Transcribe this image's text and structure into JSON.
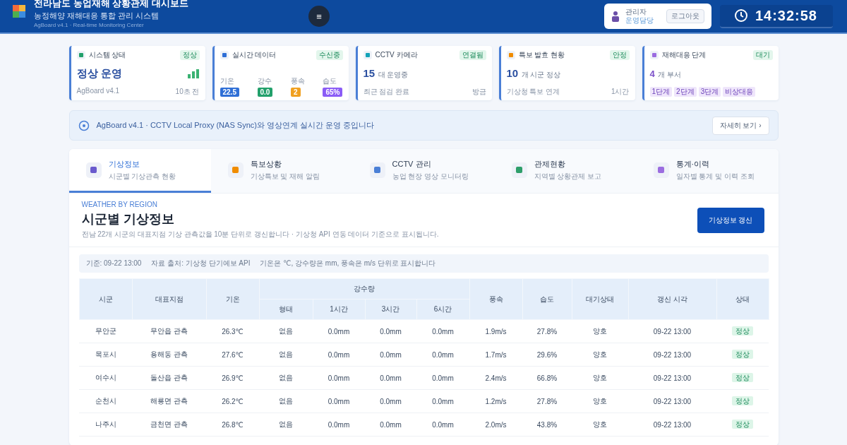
{
  "header": {
    "title": "전라남도 농업재해 상황관제 대시보드",
    "subtitle": "농정해양 재해대응 통합 관리 시스템",
    "caption": "AgBoard v4.1 · Real-time Monitoring Center",
    "menu_button": "≡",
    "user": {
      "name": "관리자",
      "role": "운영담당",
      "logout": "로그아웃"
    },
    "clock": "14:32:58"
  },
  "stat_cards": [
    {
      "kind": "value",
      "title": "시스템 상태",
      "badge": "정상",
      "color": "#22a06b",
      "value": "정상 운영",
      "footer_left": "AgBoard v4.1",
      "footer_right": "10초 전"
    },
    {
      "kind": "metrics",
      "title": "실시간 데이터",
      "badge": "수신중",
      "color": "#2f6fd6",
      "metrics": [
        {
          "label": "기온",
          "value": "22.5",
          "color": "#2f6fd6"
        },
        {
          "label": "강수",
          "value": "0.0",
          "color": "#22a06b"
        },
        {
          "label": "풍속",
          "value": "2",
          "color": "#f0a020"
        },
        {
          "label": "습도",
          "value": "65%",
          "color": "#8b5cf6"
        }
      ]
    },
    {
      "kind": "count",
      "title": "CCTV 카메라",
      "badge": "연결됨",
      "color": "#14a3b8",
      "value": "15",
      "unit": "대 운영중",
      "footer_left": "최근 점검 완료",
      "footer_right": "방금"
    },
    {
      "kind": "count",
      "title": "특보 발효 현황",
      "badge": "안정",
      "color": "#f08c00",
      "value": "10",
      "unit": "개 시군 정상",
      "footer_left": "기상청 특보 연계",
      "footer_right": "1시간"
    },
    {
      "kind": "tags",
      "title": "재해대응 단계",
      "badge": "대기",
      "color": "#9b6ce0",
      "value": "4",
      "unit": "개 부서",
      "tags": [
        "1단계",
        "2단계",
        "3단계",
        "비상대응"
      ]
    }
  ],
  "banner": {
    "text": "AgBoard v4.1 · CCTV Local Proxy (NAS Sync)와 영상연계 실시간 운영 중입니다",
    "button": "자세히 보기 ›"
  },
  "tabs": [
    {
      "label": "기상정보",
      "sub": "시군별 기상관측 현황",
      "color": "#6a5acd",
      "selected": true
    },
    {
      "label": "특보상황",
      "sub": "기상특보 및 재해 알림",
      "color": "#f08c00",
      "selected": false
    },
    {
      "label": "CCTV 관리",
      "sub": "농업 현장 영상 모니터링",
      "color": "#4a7fd6",
      "selected": false
    },
    {
      "label": "관제현황",
      "sub": "지역별 상황관제 보고",
      "color": "#2e9e6a",
      "selected": false
    },
    {
      "label": "통계·이력",
      "sub": "일자별 통계 및 이력 조회",
      "color": "#9b6ce0",
      "selected": false
    }
  ],
  "section": {
    "eyebrow": "WEATHER BY REGION",
    "title": "시군별 기상정보",
    "description": "전남 22개 시군의 대표지점 기상 관측값을 10분 단위로 갱신합니다 · 기상청 API 연동 데이터 기준으로 표시됩니다.",
    "button": "기상정보 갱신"
  },
  "filter_bar": [
    "기준: 09-22 13:00",
    "자료 출처: 기상청 단기예보 API",
    "기온은 ℃, 강수량은 mm, 풍속은 m/s 단위로 표시합니다"
  ],
  "table": {
    "columns": [
      {
        "label": "시군"
      },
      {
        "label": "대표지점"
      },
      {
        "label": "기온"
      },
      {
        "label": "강수량",
        "colspan": 4,
        "children": [
          {
            "label": "형태"
          },
          {
            "label": "1시간"
          },
          {
            "label": "3시간"
          },
          {
            "label": "6시간"
          }
        ]
      },
      {
        "label": "풍속"
      },
      {
        "label": "습도"
      },
      {
        "label": "대기상태"
      },
      {
        "label": "갱신 시각"
      },
      {
        "label": "상태"
      }
    ],
    "rows": [
      [
        "무안군",
        "무안읍 관측",
        "26.3℃",
        "없음",
        "0.0mm",
        "0.0mm",
        "0.0mm",
        "1.9m/s",
        "27.8%",
        "양호",
        "09-22 13:00",
        "정상"
      ],
      [
        "목포시",
        "용해동 관측",
        "27.6℃",
        "없음",
        "0.0mm",
        "0.0mm",
        "0.0mm",
        "1.7m/s",
        "29.6%",
        "양호",
        "09-22 13:00",
        "정상"
      ],
      [
        "여수시",
        "돌산읍 관측",
        "26.9℃",
        "없음",
        "0.0mm",
        "0.0mm",
        "0.0mm",
        "2.4m/s",
        "66.8%",
        "양호",
        "09-22 13:00",
        "정상"
      ],
      [
        "순천시",
        "해룡면 관측",
        "26.2℃",
        "없음",
        "0.0mm",
        "0.0mm",
        "0.0mm",
        "1.2m/s",
        "27.8%",
        "양호",
        "09-22 13:00",
        "정상"
      ],
      [
        "나주시",
        "금천면 관측",
        "26.8℃",
        "없음",
        "0.0mm",
        "0.0mm",
        "0.0mm",
        "2.0m/s",
        "43.8%",
        "양호",
        "09-22 13:00",
        "정상"
      ]
    ]
  }
}
